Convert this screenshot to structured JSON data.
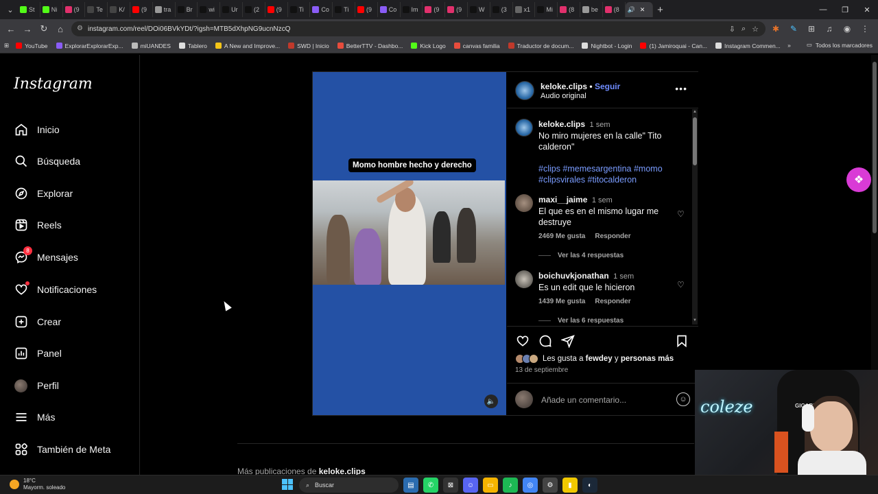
{
  "browser": {
    "tabs": [
      {
        "label": "St",
        "color": "#53fc18"
      },
      {
        "label": "Ni",
        "color": "#53fc18"
      },
      {
        "label": "(9",
        "color": "#e1306c"
      },
      {
        "label": "Te",
        "color": "#444"
      },
      {
        "label": "K/",
        "color": "#444"
      },
      {
        "label": "(9",
        "color": "#ff0000"
      },
      {
        "label": "tra",
        "color": "#999"
      },
      {
        "label": "Br",
        "color": "#111"
      },
      {
        "label": "wi",
        "color": "#111"
      },
      {
        "label": "Ur",
        "color": "#111"
      },
      {
        "label": "(2",
        "color": "#111"
      },
      {
        "label": "(9",
        "color": "#ff0000"
      },
      {
        "label": "Ti",
        "color": "#111"
      },
      {
        "label": "Co",
        "color": "#8a5cf6"
      },
      {
        "label": "Ti",
        "color": "#111"
      },
      {
        "label": "(9",
        "color": "#ff0000"
      },
      {
        "label": "Co",
        "color": "#8a5cf6"
      },
      {
        "label": "Im",
        "color": "#111"
      },
      {
        "label": "(9",
        "color": "#e1306c"
      },
      {
        "label": "(9",
        "color": "#e1306c"
      },
      {
        "label": "W",
        "color": "#111"
      },
      {
        "label": "(3",
        "color": "#111"
      },
      {
        "label": "x1",
        "color": "#666"
      },
      {
        "label": "Mi",
        "color": "#111"
      },
      {
        "label": "(8",
        "color": "#e1306c"
      },
      {
        "label": "be",
        "color": "#999"
      },
      {
        "label": "(8",
        "color": "#e1306c"
      }
    ],
    "url": "instagram.com/reel/DOi06BVkYDt/?igsh=MTB5dXhpNG9ucnNzcQ",
    "bookmarks": [
      {
        "label": "YouTube",
        "color": "#ff0000"
      },
      {
        "label": "ExplorarExplorarExp...",
        "color": "#8a5cf6"
      },
      {
        "label": "miUANDES",
        "color": "#bbbbbb"
      },
      {
        "label": "Tablero",
        "color": "#dddddd"
      },
      {
        "label": "A New and Improve...",
        "color": "#f5c518"
      },
      {
        "label": "SWD | Inicio",
        "color": "#c0392b"
      },
      {
        "label": "BetterTTV - Dashbo...",
        "color": "#e74c3c"
      },
      {
        "label": "Kick Logo",
        "color": "#53fc18"
      },
      {
        "label": "canvas familia",
        "color": "#e74c3c"
      },
      {
        "label": "Traductor de docum...",
        "color": "#c0392b"
      },
      {
        "label": "Nightbot - Login",
        "color": "#dddddd"
      },
      {
        "label": "(1) Jamiroquai - Can...",
        "color": "#ff0000"
      },
      {
        "label": "Instagram Commen...",
        "color": "#dddddd"
      }
    ],
    "all_bookmarks": "Todos los marcadores"
  },
  "sidebar": {
    "logo": "Instagram",
    "items": [
      {
        "label": "Inicio",
        "icon": "home-icon"
      },
      {
        "label": "Búsqueda",
        "icon": "search-icon"
      },
      {
        "label": "Explorar",
        "icon": "compass-icon"
      },
      {
        "label": "Reels",
        "icon": "reels-icon"
      },
      {
        "label": "Mensajes",
        "icon": "messenger-icon",
        "badge": "8"
      },
      {
        "label": "Notificaciones",
        "icon": "heart-icon"
      },
      {
        "label": "Crear",
        "icon": "plus-square-icon"
      },
      {
        "label": "Panel",
        "icon": "chart-icon"
      },
      {
        "label": "Perfil",
        "icon": "avatar"
      },
      {
        "label": "Más",
        "icon": "menu-icon"
      },
      {
        "label": "También de Meta",
        "icon": "meta-apps-icon"
      }
    ]
  },
  "post": {
    "video_caption": "Momo hombre hecho y derecho",
    "author": "keloke.clips",
    "follow": "Seguir",
    "audio": "Audio original",
    "caption": {
      "user": "keloke.clips",
      "time": "1 sem",
      "text": "No miro mujeres en la calle\" Tito calderon\"",
      "tags": "#clips #memesargentina #momo #clipsvirales #titocalderon"
    },
    "comments": [
      {
        "user": "maxi__jaime",
        "time": "1 sem",
        "text": "El que es en el mismo lugar me destruye",
        "likes": "2469 Me gusta",
        "reply": "Responder",
        "replies": "Ver las 4 respuestas"
      },
      {
        "user": "boichuvkjonathan",
        "time": "1 sem",
        "text": "Es un edit que le hicieron",
        "likes": "1439 Me gusta",
        "reply": "Responder",
        "replies": "Ver las 6 respuestas"
      }
    ],
    "likes_prefix": "Les gusta a",
    "likes_user": "fewdey",
    "likes_and": "y",
    "likes_more": "personas más",
    "date": "13 de septiembre",
    "comment_placeholder": "Añade un comentario..."
  },
  "more_posts": {
    "prefix": "Más publicaciones de",
    "user": "keloke.clips"
  },
  "webcam": {
    "neon_text": "coleze",
    "chair_brand": "GIGABYTE"
  },
  "taskbar": {
    "temp": "18°C",
    "weather": "Mayorm. soleado",
    "search": "Buscar"
  },
  "colors": {
    "video_bg": "#2451a5",
    "link_blue": "#6f8cff",
    "hashtag_blue": "#7a9cff",
    "badge_red": "#ff3040"
  }
}
